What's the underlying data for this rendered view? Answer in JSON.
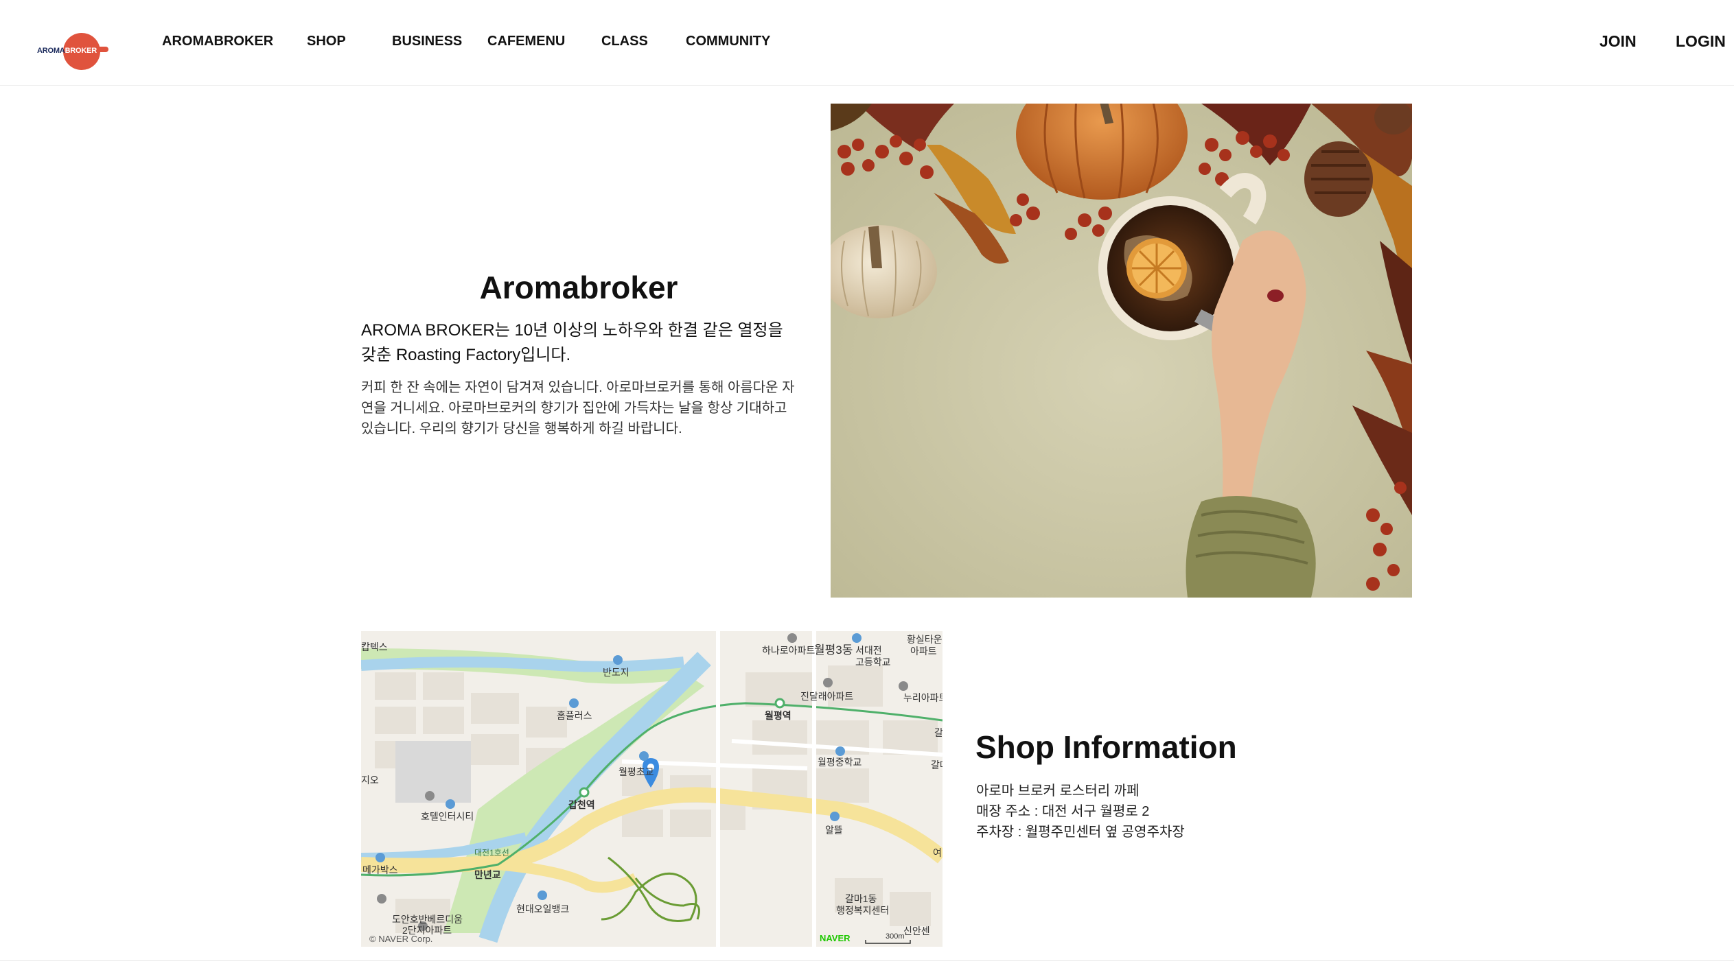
{
  "logo": {
    "text_part1": "AROMA",
    "text_part2": "BROKER"
  },
  "nav": [
    "AROMABROKER",
    "SHOP",
    "BUSINESS",
    "CAFEMENU",
    "CLASS",
    "COMMUNITY"
  ],
  "auth": {
    "join": "JOIN",
    "login": "LOGIN"
  },
  "about": {
    "title": "Aromabroker",
    "lead": "AROMA BROKER는 10년 이상의 노하우와 한결 같은 열정을 갖춘 Roasting Factory입니다.",
    "body": "커피 한 잔 속에는 자연이 담겨져 있습니다. 아로마브로커를 통해 아름다운 자연을 거니세요. 아로마브로커의 향기가 집안에 가득차는 날을 항상 기대하고 있습니다. 우리의 향기가 당신을 행복하게 하길 바랍니다."
  },
  "shop": {
    "title": "Shop Information",
    "name": "아로마 브로커 로스터리 까페",
    "address": "매장 주소 : 대전 서구 월평로 2",
    "parking": "주차장 : 월평주민센터 옆 공영주차장"
  },
  "map": {
    "labels": {
      "hanaro": "하나로아파트",
      "wolpyeong3": "월평3동",
      "daejeon_hs": "서대전",
      "daejeon_hs2": "고등학교",
      "hwangsil": "황실타운",
      "hwangsil2": "아파트",
      "capitel": "캅텍스",
      "bandoji": "반도지",
      "jindalrae": "진달래아파트",
      "nuri": "누리아파트",
      "homeplus": "홈플러스",
      "wolpyeong_station": "월평역",
      "wolpyeong_ms": "월평중학교",
      "wolpyeong_elem": "월평초교",
      "jio": "지오",
      "gapcheon_station": "갑천역",
      "hotel": "호텔인터시티",
      "daejeon_line": "대전1호선",
      "almi": "알뜰",
      "megabox": "메가박스",
      "mannyeon": "만년교",
      "hyundai": "현대오일뱅크",
      "galma1": "갈마1동",
      "galma1b": "행정복지센터",
      "doan": "도안호반베르디움",
      "doan2": "2단지아파트",
      "sinansel": "신안센",
      "gal": "갈",
      "galma": "갈마",
      "yeo": "여",
      "copyright": "© NAVER Corp.",
      "naver": "NAVER",
      "scale": "300m"
    }
  },
  "colors": {
    "brand": "#e0533d",
    "brand_dark": "#1b2a5c",
    "map_water": "#a9d3ec",
    "map_park": "#cde8b4",
    "map_road": "#f6e39a",
    "map_subway": "#4fb06a",
    "map_pin": "#3b8be0"
  }
}
